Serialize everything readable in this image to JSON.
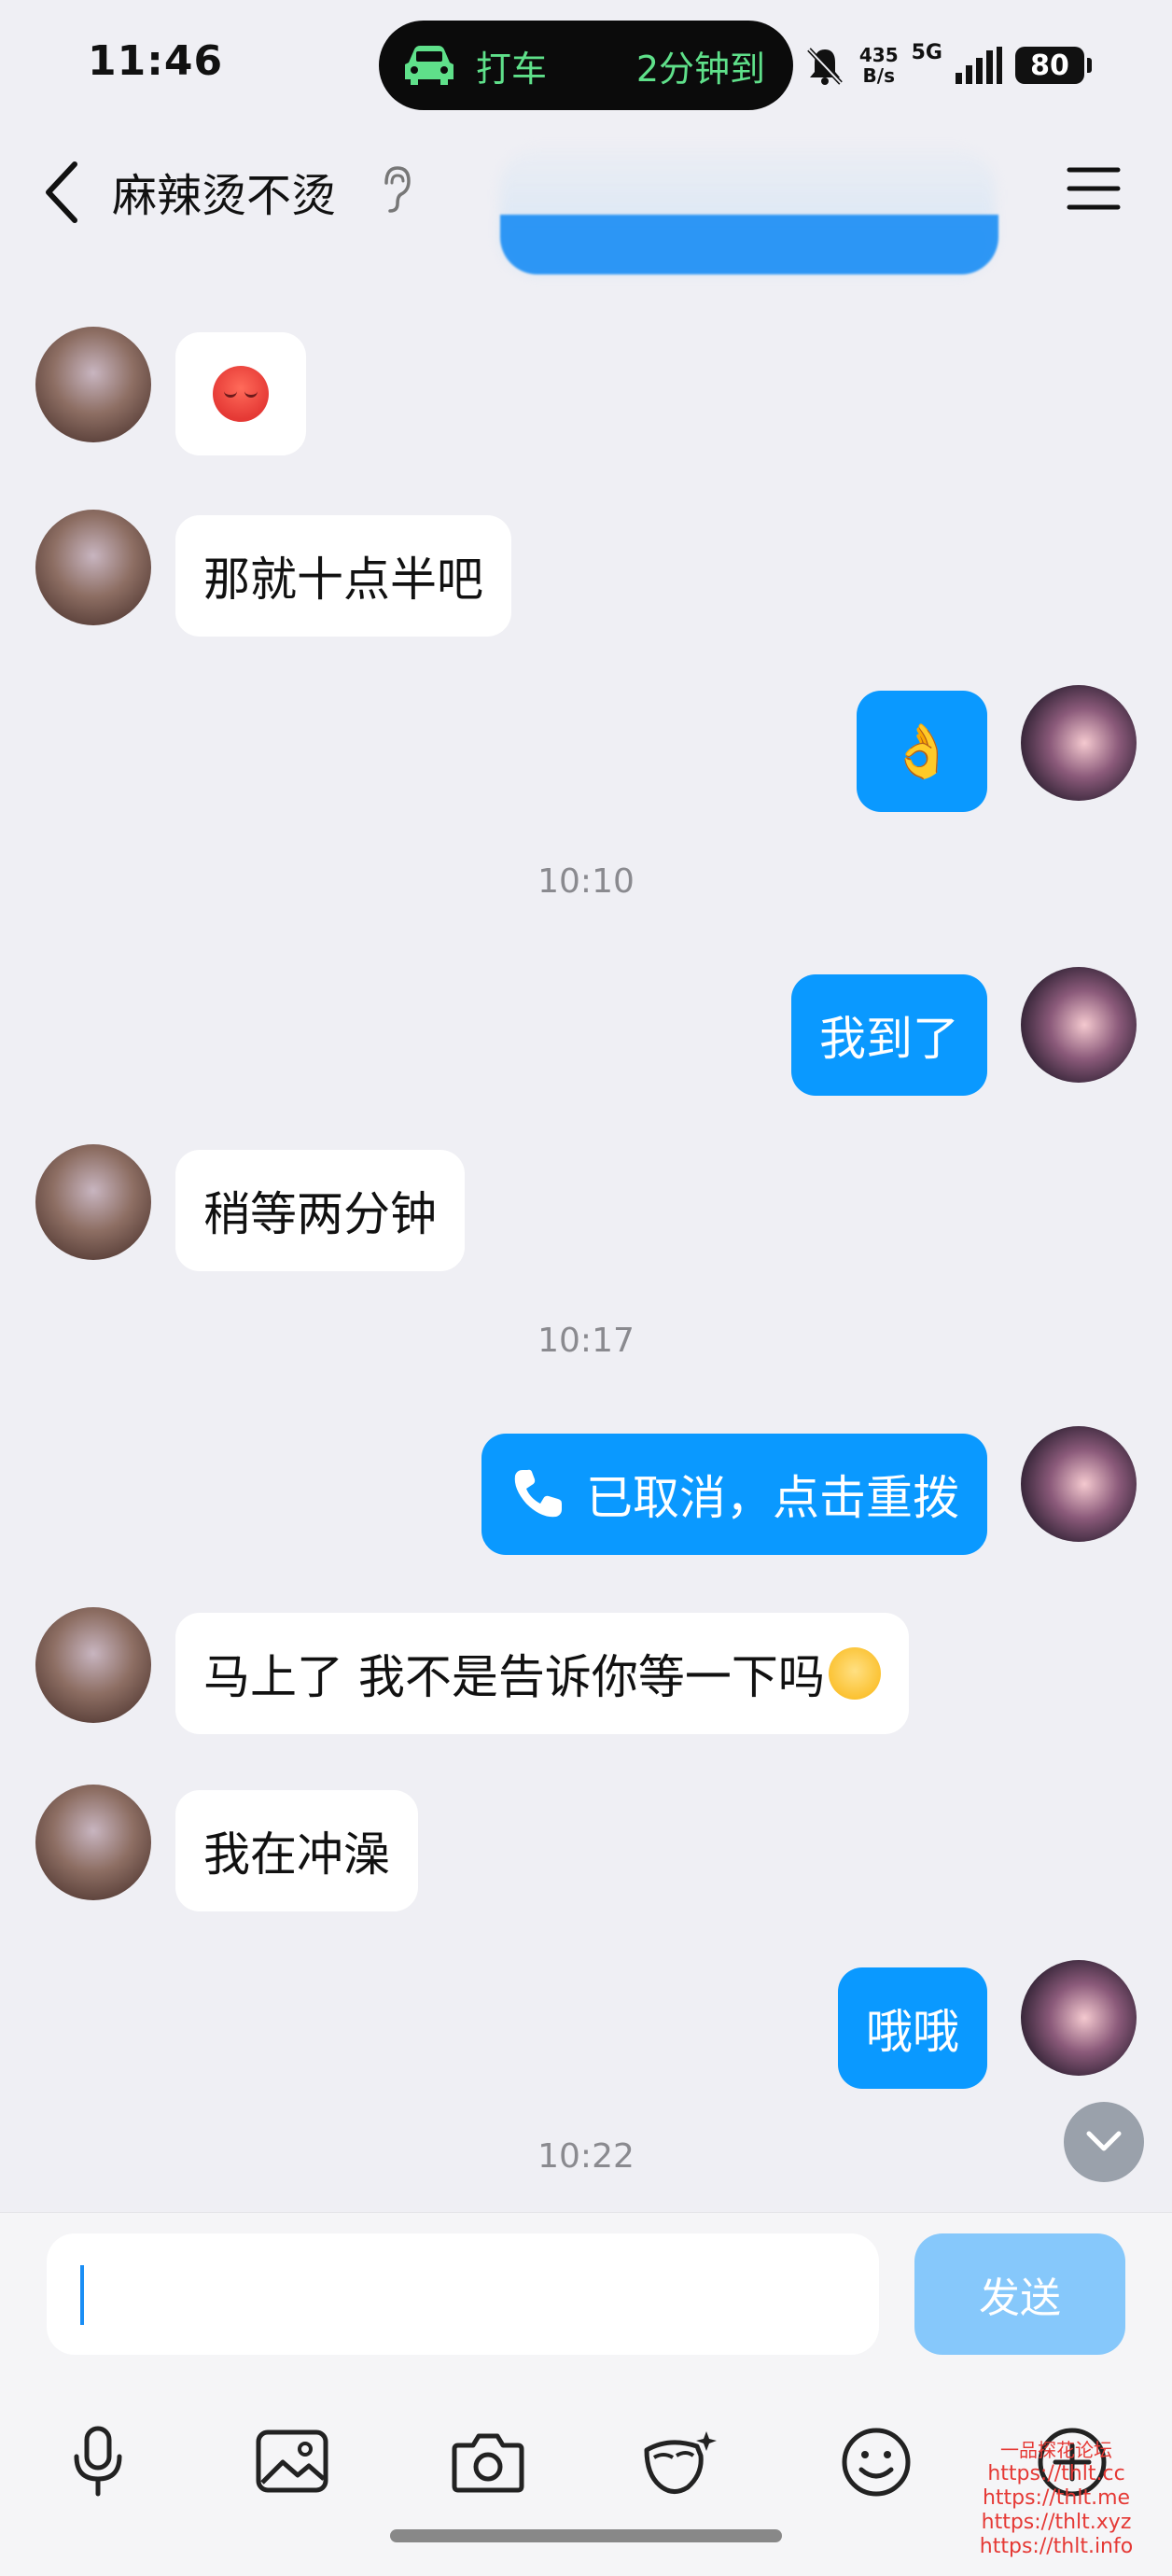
{
  "status_bar": {
    "time": "11:46",
    "ride_label": "打车",
    "ride_eta": "2分钟到",
    "net_speed_value": "435",
    "net_speed_unit": "B/s",
    "network": "5G",
    "battery": "80"
  },
  "header": {
    "title": "麻辣烫不烫"
  },
  "messages": [
    {
      "side": "in",
      "type": "emoji",
      "emoji": "pensive-red-face"
    },
    {
      "side": "in",
      "type": "text",
      "text": "那就十点半吧"
    },
    {
      "side": "out",
      "type": "emoji",
      "text": "👌"
    },
    {
      "type": "time",
      "text": "10:10"
    },
    {
      "side": "out",
      "type": "text",
      "text": "我到了"
    },
    {
      "side": "in",
      "type": "text",
      "text": "稍等两分钟"
    },
    {
      "type": "time",
      "text": "10:17"
    },
    {
      "side": "out",
      "type": "call",
      "text": "已取消，点击重拨"
    },
    {
      "side": "in",
      "type": "text",
      "text": "马上了 我不是告诉你等一下吗",
      "emoji": "laughing-face"
    },
    {
      "side": "in",
      "type": "text",
      "text": "我在冲澡"
    },
    {
      "side": "out",
      "type": "text",
      "text": "哦哦"
    },
    {
      "type": "time",
      "text": "10:22"
    }
  ],
  "input": {
    "value": "",
    "send_label": "发送"
  },
  "toolbar_icons": [
    "microphone-icon",
    "image-icon",
    "camera-icon",
    "red-packet-icon",
    "emoji-icon",
    "plus-icon"
  ],
  "watermark": {
    "title": "一品探花论坛",
    "urls": [
      "https://thlt.cc",
      "https://thlt.me",
      "https://thlt.xyz",
      "https://thlt.info"
    ]
  },
  "colors": {
    "background": "#efeff4",
    "outgoing_bubble": "#0a99ff",
    "incoming_bubble": "#ffffff",
    "send_button_disabled": "#86c8fb",
    "ride_pill_text": "#5fe08a"
  }
}
